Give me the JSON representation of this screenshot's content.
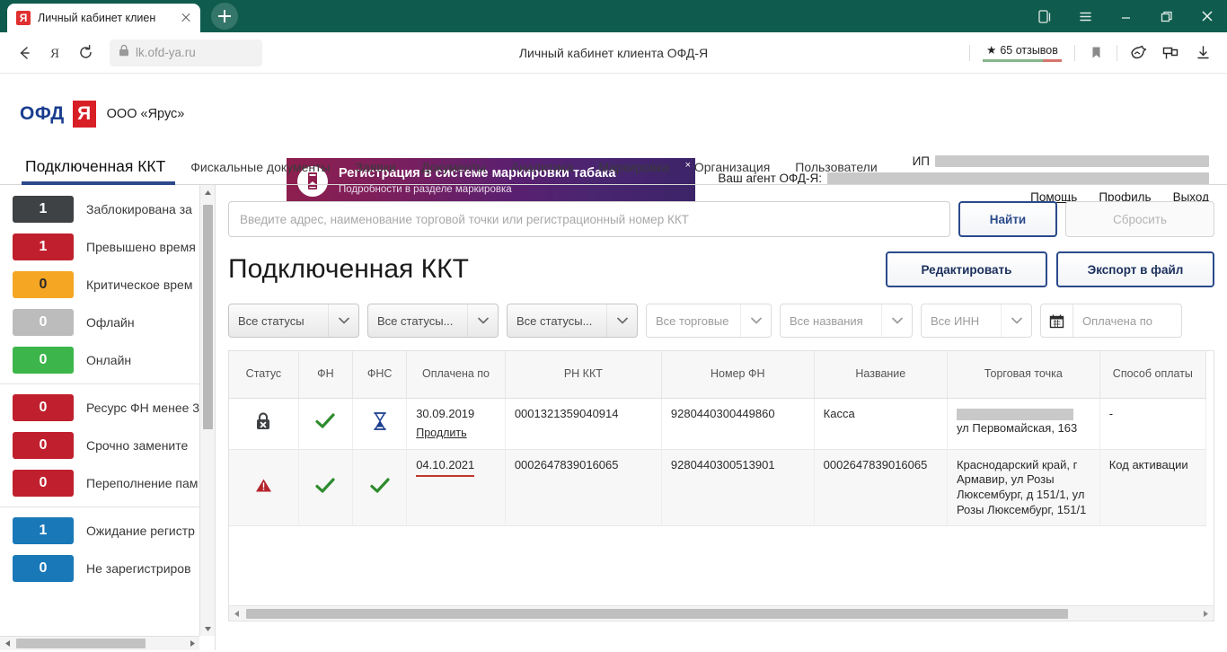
{
  "browser": {
    "tab": {
      "title": "Личный кабинет клиен",
      "favicon_letter": "Я"
    },
    "new_tab_label": "+",
    "url": "lk.ofd-ya.ru",
    "page_heading": "Личный кабинет клиента ОФД-Я",
    "reviews": {
      "count_text": "65 отзывов",
      "star": "★"
    },
    "accent_green": "#0f5c4e",
    "window_controls": [
      "menu",
      "minimize",
      "maximize",
      "close"
    ]
  },
  "site": {
    "logo_ofd": "ОФД",
    "logo_dot": "·",
    "logo_ya": "Я",
    "org_name": "ООО «Ярус»",
    "banner": {
      "title": "Регистрация в системе маркировки табака",
      "subtitle": "Подробности в разделе маркировка",
      "close": "×"
    },
    "account": {
      "ip_label": "ИП",
      "agent_label": "Ваш агент ОФД-Я:",
      "links": [
        "Помощь",
        "Профиль",
        "Выход"
      ]
    },
    "navtabs": [
      {
        "label": "Подключенная ККТ",
        "active": true
      },
      {
        "label": "Фискальные документы",
        "active": false
      },
      {
        "label": "Заявки",
        "active": false
      },
      {
        "label": "Документы",
        "active": false
      },
      {
        "label": "Аналитика",
        "active": false
      },
      {
        "label": "Маркировка",
        "active": false
      },
      {
        "label": "Организация",
        "active": false
      },
      {
        "label": "Пользователи",
        "active": false
      }
    ]
  },
  "sidebar": {
    "items": [
      {
        "count": "1",
        "label": "Заблокирована за",
        "color": "#3f4245"
      },
      {
        "count": "1",
        "label": "Превышено время",
        "color": "#c0202d"
      },
      {
        "count": "0",
        "label": "Критическое врем",
        "color": "#f5a623"
      },
      {
        "count": "0",
        "label": "Офлайн",
        "color": "#bcbcbc"
      },
      {
        "count": "0",
        "label": "Онлайн",
        "color": "#3cb54a"
      },
      {
        "count": "0",
        "label": "Ресурс ФН менее 3",
        "color": "#c0202d",
        "divider_before": true
      },
      {
        "count": "0",
        "label": "Срочно замените",
        "color": "#c0202d"
      },
      {
        "count": "0",
        "label": "Переполнение пам",
        "color": "#c0202d"
      },
      {
        "count": "1",
        "label": "Ожидание регистр",
        "color": "#1978b8",
        "divider_before": true
      },
      {
        "count": "0",
        "label": "Не зарегистриров",
        "color": "#1978b8"
      }
    ]
  },
  "main": {
    "search": {
      "placeholder": "Введите адрес, наименование торговой точки или регистрационный номер ККТ",
      "value": ""
    },
    "find_button": "Найти",
    "reset_button": "Сбросить",
    "page_title": "Подключенная ККТ",
    "edit_button": "Редактировать",
    "export_button": "Экспорт в файл",
    "filters": [
      {
        "label": "Все статусы",
        "style": "filled"
      },
      {
        "label": "Все статусы...",
        "style": "filled"
      },
      {
        "label": "Все статусы...",
        "style": "filled"
      },
      {
        "label": "Все торговые",
        "style": "plain"
      },
      {
        "label": "Все названия",
        "style": "plain"
      },
      {
        "label": "Все ИНН",
        "style": "plain"
      }
    ],
    "date_filter": {
      "icon": "calendar-icon",
      "placeholder": "Оплачена по"
    },
    "table": {
      "columns": [
        "Статус",
        "ФН",
        "ФНС",
        "Оплачена по",
        "РН ККТ",
        "Номер ФН",
        "Название",
        "Торговая точка",
        "Способ оплаты"
      ],
      "rows": [
        {
          "status_icon": "lock-blocked-icon",
          "fn_icon": "check-green-icon",
          "fns_icon": "hourglass-blue-icon",
          "paid_until": "30.09.2019",
          "paid_link": "Продлить",
          "paid_overdue": false,
          "rn_kkt": "0001321359040914",
          "fn_number": "9280440300449860",
          "name": "Касса",
          "outlet_redacted": true,
          "outlet": "ул Первомайская, 163",
          "payment_method": "-"
        },
        {
          "status_icon": "warning-triangle-red-icon",
          "fn_icon": "check-green-icon",
          "fns_icon": "check-green-icon",
          "paid_until": "04.10.2021",
          "paid_link": "",
          "paid_overdue": true,
          "rn_kkt": "0002647839016065",
          "fn_number": "9280440300513901",
          "name": "0002647839016065",
          "outlet_redacted": false,
          "outlet": "Краснодарский край, г Армавир, ул Розы Люксембург, д 151/1, ул Розы Люксембург, 151/1",
          "payment_method": "Код активации"
        }
      ]
    }
  },
  "colors": {
    "brand_blue": "#2b4a8b",
    "brand_red": "#d81f26",
    "browser_green": "#0f5c4e",
    "green_check": "#2e8b2e",
    "red_alert": "#c0202d"
  }
}
